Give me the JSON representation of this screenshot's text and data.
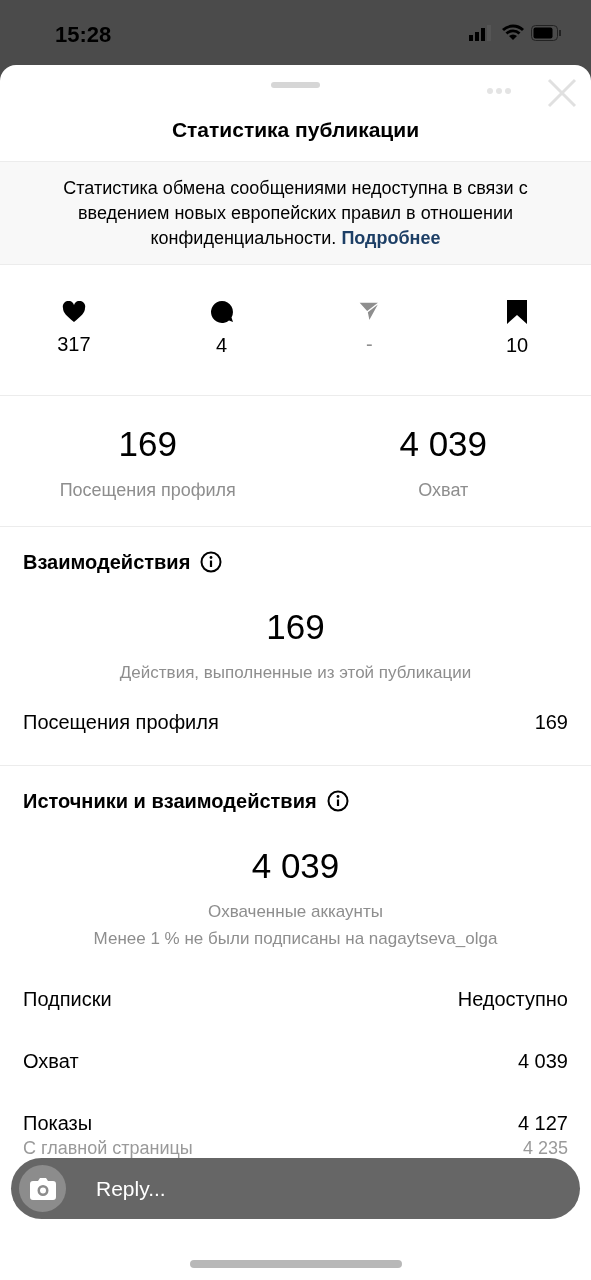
{
  "status_bar": {
    "time": "15:28"
  },
  "sheet": {
    "title": "Статистика публикации"
  },
  "notice": {
    "text": "Статистика обмена сообщениями недоступна в связи с введением новых европейских правил в отношении конфиденциальности.",
    "link": "Подробнее"
  },
  "counters": [
    {
      "kind": "likes",
      "value": "317",
      "disabled": false
    },
    {
      "kind": "comments",
      "value": "4",
      "disabled": false
    },
    {
      "kind": "shares",
      "value": "-",
      "disabled": true
    },
    {
      "kind": "saves",
      "value": "10",
      "disabled": false
    }
  ],
  "highlights": [
    {
      "value": "169",
      "label": "Посещения профиля"
    },
    {
      "value": "4 039",
      "label": "Охват"
    }
  ],
  "sections": [
    {
      "title": "Взаимодействия",
      "total": "169",
      "captions": [
        "Действия, выполненные из этой публикации"
      ],
      "rows": [
        {
          "kind": "main",
          "label": "Посещения профиля",
          "value": "169"
        }
      ]
    },
    {
      "title": "Источники и взаимодействия",
      "total": "4 039",
      "captions": [
        "Охваченные аккаунты",
        "Менее 1 % не были подписаны на nagaytseva_olga"
      ],
      "rows": [
        {
          "kind": "main",
          "label": "Подписки",
          "value": "Недоступно"
        },
        {
          "kind": "main",
          "label": "Охват",
          "value": "4 039"
        },
        {
          "kind": "main",
          "label": "Показы",
          "value": "4 127"
        },
        {
          "kind": "sub",
          "label": "С главной страницы",
          "value": "4 235"
        }
      ]
    }
  ],
  "reply_bar": {
    "placeholder": "Reply..."
  }
}
